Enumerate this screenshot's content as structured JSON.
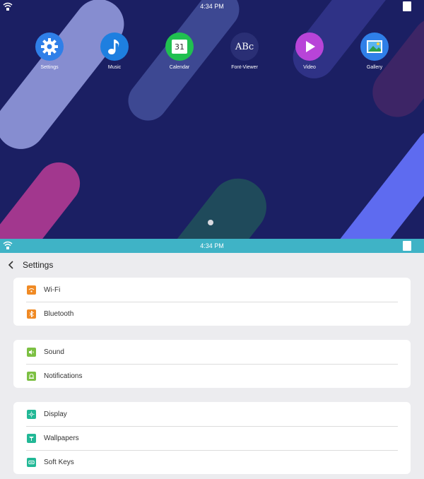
{
  "home": {
    "statusbar": {
      "time": "4:34 PM"
    },
    "apps": [
      {
        "label": "Settings",
        "icon": "settings-gear-icon",
        "color": "#2f7fe8"
      },
      {
        "label": "Music",
        "icon": "music-note-icon",
        "color": "#1e7fe0"
      },
      {
        "label": "Calendar",
        "icon": "calendar-icon",
        "color": "#20c050",
        "calendar_day": "31"
      },
      {
        "label": "Font-Viewer",
        "icon": "font-viewer-icon",
        "color": "#2a2f75",
        "glyph": "ABc"
      },
      {
        "label": "Video",
        "icon": "play-icon",
        "color": "#b844d8"
      },
      {
        "label": "Gallery",
        "icon": "gallery-icon",
        "color": "#2f7fe8"
      }
    ]
  },
  "settings": {
    "statusbar": {
      "time": "4:34 PM",
      "accent": "#3fb3c6"
    },
    "title": "Settings",
    "groups": [
      {
        "items": [
          {
            "label": "Wi-Fi",
            "icon": "wifi-icon",
            "color": "#f08a24"
          },
          {
            "label": "Bluetooth",
            "icon": "bluetooth-icon",
            "color": "#f08a24"
          }
        ]
      },
      {
        "items": [
          {
            "label": "Sound",
            "icon": "sound-icon",
            "color": "#7cc043"
          },
          {
            "label": "Notifications",
            "icon": "bell-icon",
            "color": "#7cc043"
          }
        ]
      },
      {
        "items": [
          {
            "label": "Display",
            "icon": "display-icon",
            "color": "#22b896"
          },
          {
            "label": "Wallpapers",
            "icon": "wallpaper-icon",
            "color": "#22b896"
          },
          {
            "label": "Soft Keys",
            "icon": "soft-keys-icon",
            "color": "#22b896"
          }
        ]
      }
    ]
  }
}
